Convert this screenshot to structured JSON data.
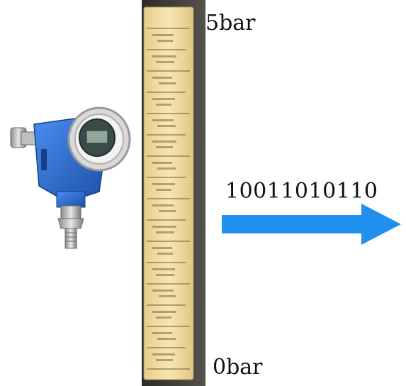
{
  "scale": {
    "top_label": "5bar",
    "bottom_label": "0bar"
  },
  "signal": {
    "binary_output": "10011010110"
  },
  "colors": {
    "arrow": "#1f8ff0",
    "transmitter_body": "#2e6fd1",
    "scale_paper": "#f3dfa6",
    "scale_frame": "#3b3a36"
  },
  "icons": {
    "device": "pressure-transmitter-icon",
    "arrow": "arrow-right-icon"
  }
}
